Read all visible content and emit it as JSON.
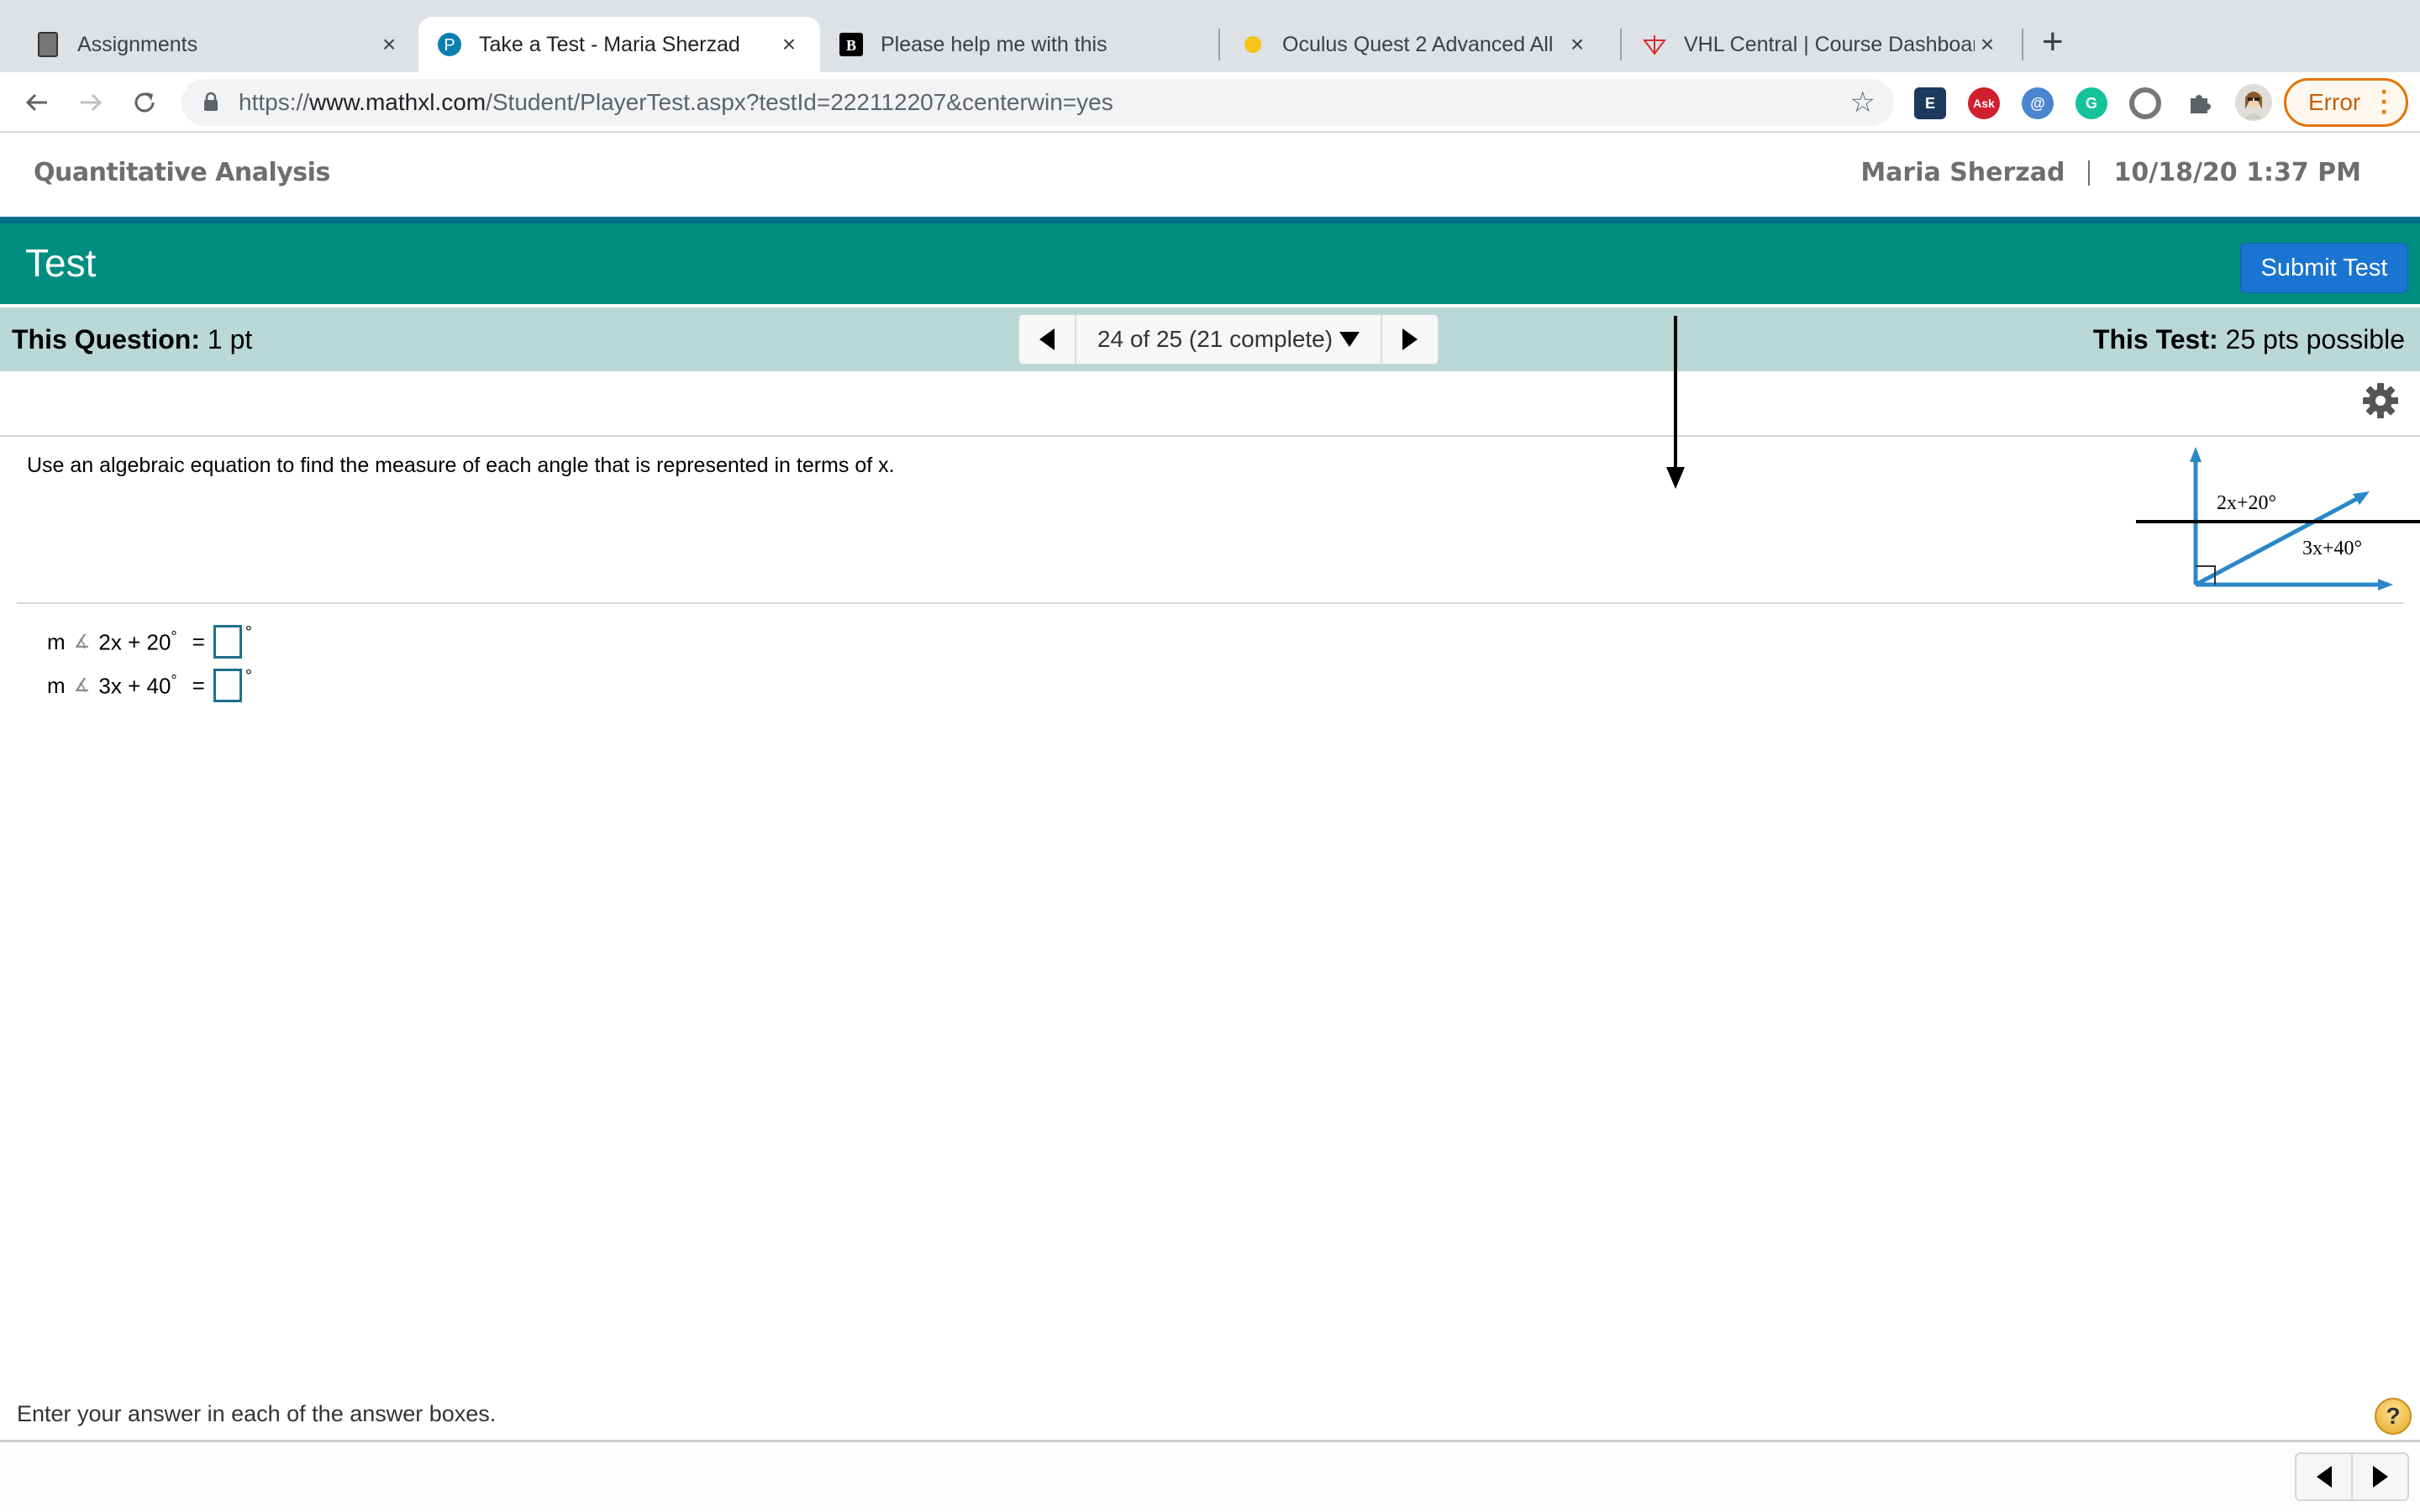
{
  "browser": {
    "tabs": [
      {
        "title": "Assignments",
        "icon": "tablet-icon",
        "active": false
      },
      {
        "title": "Take a Test - Maria Sherzad",
        "icon": "pearson-icon",
        "active": true
      },
      {
        "title": "Please help me with this",
        "icon": "brainly-icon",
        "active": false
      },
      {
        "title": "Oculus Quest 2 Advanced All",
        "icon": "oculus-icon",
        "active": false
      },
      {
        "title": "VHL Central | Course Dashboard",
        "icon": "vhl-icon",
        "active": false
      }
    ],
    "close_glyph": "×",
    "new_tab_glyph": "+",
    "url_prefix": "https://",
    "url_host": "www.mathxl.com",
    "url_path": "/Student/PlayerTest.aspx?testId=222112207&centerwin=yes",
    "extensions": [
      "easybib-icon",
      "ask-icon",
      "email-icon",
      "grammarly-icon",
      "circle-extension-icon",
      "puzzle-icon",
      "profile-avatar"
    ],
    "error_label": "Error"
  },
  "page": {
    "course_name": "Quantitative Analysis",
    "user_name": "Maria Sherzad",
    "datetime": "10/18/20 1:37 PM",
    "test_title": "Test",
    "submit_label": "Submit Test",
    "this_question_label": "This Question:",
    "this_question_value": "1 pt",
    "nav_position": "24 of 25 (21 complete)",
    "this_test_label": "This Test:",
    "this_test_value": "25 pts possible",
    "question_text": "Use an algebraic equation to find the measure of each angle that is represented in terms of x.",
    "diagram": {
      "label_upper": "2x+20°",
      "label_lower": "3x+40°",
      "line_color": "#2b88c8"
    },
    "answers": [
      {
        "prefix": "m",
        "angle_symbol": "∡",
        "expr": "2x + 20",
        "degree": "°",
        "equals": "=",
        "value": "",
        "unit": "°"
      },
      {
        "prefix": "m",
        "angle_symbol": "∡",
        "expr": "3x + 40",
        "degree": "°",
        "equals": "=",
        "value": "",
        "unit": "°"
      }
    ],
    "footer_hint": "Enter your answer in each of the answer boxes.",
    "help_glyph": "?"
  },
  "colors": {
    "teal": "#008e81",
    "question_bar": "#bad8d5",
    "submit_blue": "#1a74d1",
    "error_orange": "#e37400"
  }
}
